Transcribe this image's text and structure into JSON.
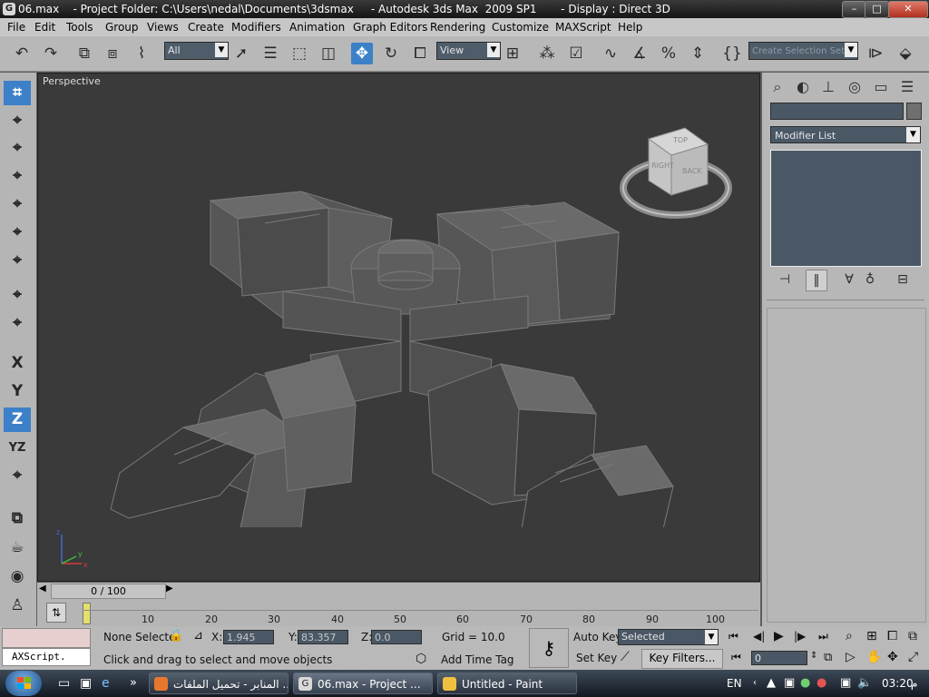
{
  "window": {
    "title": "06.max    - Project Folder: C:\\Users\\nedal\\Documents\\3dsmax     - Autodesk 3ds Max  2009 SP1       - Display : Direct 3D",
    "app_icon": "3ds-max-icon",
    "controls": {
      "minimize": "–",
      "maximize": "□",
      "close": "✕"
    }
  },
  "menu": [
    "File",
    "Edit",
    "Tools",
    "Group",
    "Views",
    "Create",
    "Modifiers",
    "Animation",
    "Graph Editors",
    "Rendering",
    "Customize",
    "MAXScript",
    "Help"
  ],
  "toolbar": {
    "selection_filter": "All",
    "reference_coord": "View",
    "named_selection": "Create Selection Set",
    "icons": [
      "undo-icon",
      "redo-icon",
      "select-and-link-icon",
      "unlink-icon",
      "bind-space-warp-icon",
      "select-object-icon",
      "select-by-name-icon",
      "rectangular-selection-icon",
      "window-crossing-icon",
      "select-and-move-icon",
      "select-and-rotate-icon",
      "select-and-scale-icon",
      "use-pivot-center-icon",
      "select-and-manipulate-icon",
      "snaps-toggle-icon",
      "angle-snap-icon",
      "percent-snap-icon",
      "spinner-snap-icon",
      "edit-named-selections-icon",
      "mirror-icon",
      "align-icon"
    ]
  },
  "left_tools": {
    "axis_labels": [
      "X",
      "Y",
      "Z",
      "YZ"
    ],
    "active_axis": "Z"
  },
  "viewport": {
    "label": "Perspective",
    "viewcube": {
      "top": "TOP",
      "right": "RIGHT",
      "back": "BACK"
    },
    "axis_labels": [
      "x",
      "y",
      "z"
    ]
  },
  "command_panel": {
    "modifier_list": "Modifier List",
    "tabs": [
      "create-tab-icon",
      "modify-tab-icon",
      "hierarchy-tab-icon",
      "motion-tab-icon",
      "display-tab-icon",
      "utilities-tab-icon"
    ],
    "stack_buttons": [
      "pin-stack-icon",
      "show-end-result-icon",
      "make-unique-icon",
      "remove-modifier-icon",
      "configure-modifier-sets-icon"
    ]
  },
  "time_slider": {
    "label": "0 / 100"
  },
  "trackbar": {
    "ticks": [
      "10",
      "20",
      "30",
      "40",
      "50",
      "60",
      "70",
      "80",
      "90",
      "100"
    ]
  },
  "status": {
    "selection": "None Selecte",
    "x_label": "X:",
    "x_value": "1.945",
    "y_label": "Y:",
    "y_value": "83.357",
    "z_label": "Z:",
    "z_value": "0.0",
    "grid": "Grid = 10.0",
    "auto_key": "Auto Key",
    "set_key": "Set Key",
    "key_mode": "Selected",
    "key_filters": "Key Filters...",
    "frame": "0",
    "prompt": "Click and drag to select and move objects",
    "add_time_tag": "Add Time Tag",
    "maxscript": "AXScript."
  },
  "taskbar": {
    "tasks": [
      {
        "label": "المنابر - تحميل الملفات ...",
        "icon": "firefox-icon"
      },
      {
        "label": "06.max     - Project ...",
        "icon": "3ds-max-icon"
      },
      {
        "label": "Untitled - Paint",
        "icon": "paint-icon"
      }
    ],
    "language": "EN",
    "time": "03:20",
    "ampm": "م",
    "expand_glyph": "»"
  }
}
